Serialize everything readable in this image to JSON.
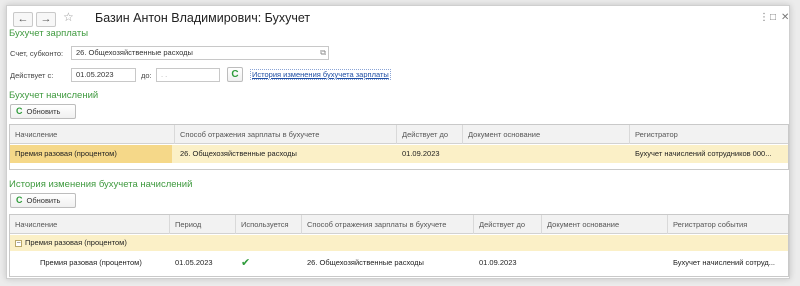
{
  "window": {
    "title": "Базин Антон Владимирович: Бухучет",
    "back_icon": "←",
    "forward_icon": "→",
    "star_icon": "☆",
    "more_icon": "⋮",
    "restore_icon": "□",
    "close_icon": "✕"
  },
  "salary_section": {
    "title": "Бухучет зарплаты",
    "account_label": "Счет, субконто:",
    "account_value": "26. Общехозяйственные расходы",
    "account_icon": "⧉",
    "valid_from_label": "Действует с:",
    "valid_from_value": "01.05.2023",
    "valid_to_label": "до:",
    "valid_to_placeholder": ". .",
    "refresh_icon": "C",
    "history_link": "История изменения бухучета зарплаты"
  },
  "accruals_section": {
    "title": "Бухучет начислений",
    "refresh_label": "Обновить",
    "refresh_icon": "C",
    "columns": [
      "Начисление",
      "Способ отражения зарплаты в бухучете",
      "Действует до",
      "Документ основание",
      "Регистратор"
    ],
    "rows": [
      {
        "accrual": "Премия разовая (процентом)",
        "method": "26. Общехозяйственные расходы",
        "valid_to": "01.09.2023",
        "document": "",
        "registrar": "Бухучет начислений сотрудников 000..."
      }
    ]
  },
  "history_section": {
    "title": "История изменения бухучета начислений",
    "refresh_label": "Обновить",
    "refresh_icon": "C",
    "columns": [
      "Начисление",
      "Период",
      "Используется",
      "Способ отражения зарплаты в бухучете",
      "Действует до",
      "Документ основание",
      "Регистратор события"
    ],
    "group_row": {
      "toggle_icon": "−",
      "label": "Премия разовая (процентом)"
    },
    "rows": [
      {
        "accrual": "Премия разовая (процентом)",
        "period": "01.05.2023",
        "used_icon": "✔",
        "method": "26. Общехозяйственные расходы",
        "valid_to": "01.09.2023",
        "document": "",
        "registrar": "Бухучет начислений сотруд..."
      }
    ]
  }
}
